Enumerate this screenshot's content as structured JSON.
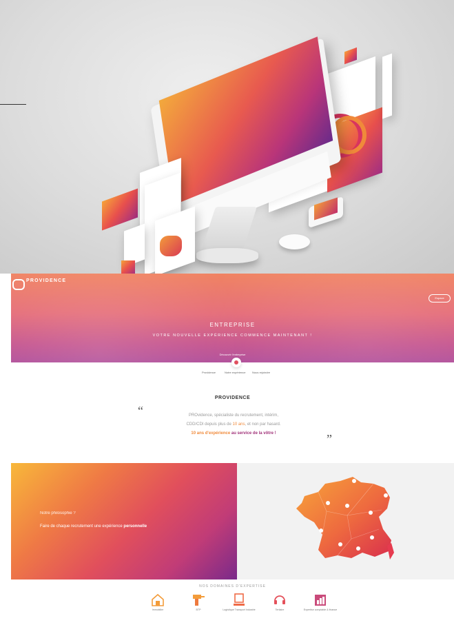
{
  "brand": {
    "name": "PROVIDENCE",
    "accent": "#e8504c",
    "gradient_start": "#f8b83a",
    "gradient_end": "#7a2a8a"
  },
  "header": {
    "login_label": "Espace",
    "title": "ENTREPRISE",
    "subtitle": "VOTRE NOUVELLE EXPÉRIENCE COMMENCE MAINTENANT !",
    "scroll_label": "Découvrir l'entreprise"
  },
  "tabs": [
    {
      "label": "Providence"
    },
    {
      "label": "Notre expérience"
    },
    {
      "label": "Nous rejoindre"
    }
  ],
  "providence": {
    "title": "PROVIDENCE",
    "line1": "PROvidence, spécialiste du recrutement, intérim,",
    "line2_a": "CDD/CDI depuis plus de ",
    "line2_highlight": "10 ans",
    "line2_b": ", et non par hasard.",
    "line3_a": "10 ans d'expérience ",
    "line3_b": "au service de la vôtre !"
  },
  "philosophy": {
    "question": "Notre philosophie ?",
    "answer_a": "Faire de chaque recrutement une expérience ",
    "answer_highlight": "personnelle"
  },
  "domains": {
    "title": "NOS DOMAINES D'EXPERTISE",
    "items": [
      {
        "label": "Immobilier",
        "icon": "house-icon"
      },
      {
        "label": "BTP",
        "icon": "drill-icon"
      },
      {
        "label": "Logistique Transport Industrie",
        "icon": "logistics-icon"
      },
      {
        "label": "Tertiaire",
        "icon": "headset-icon"
      },
      {
        "label": "Expertise comptable & finance",
        "icon": "finance-icon"
      }
    ]
  }
}
